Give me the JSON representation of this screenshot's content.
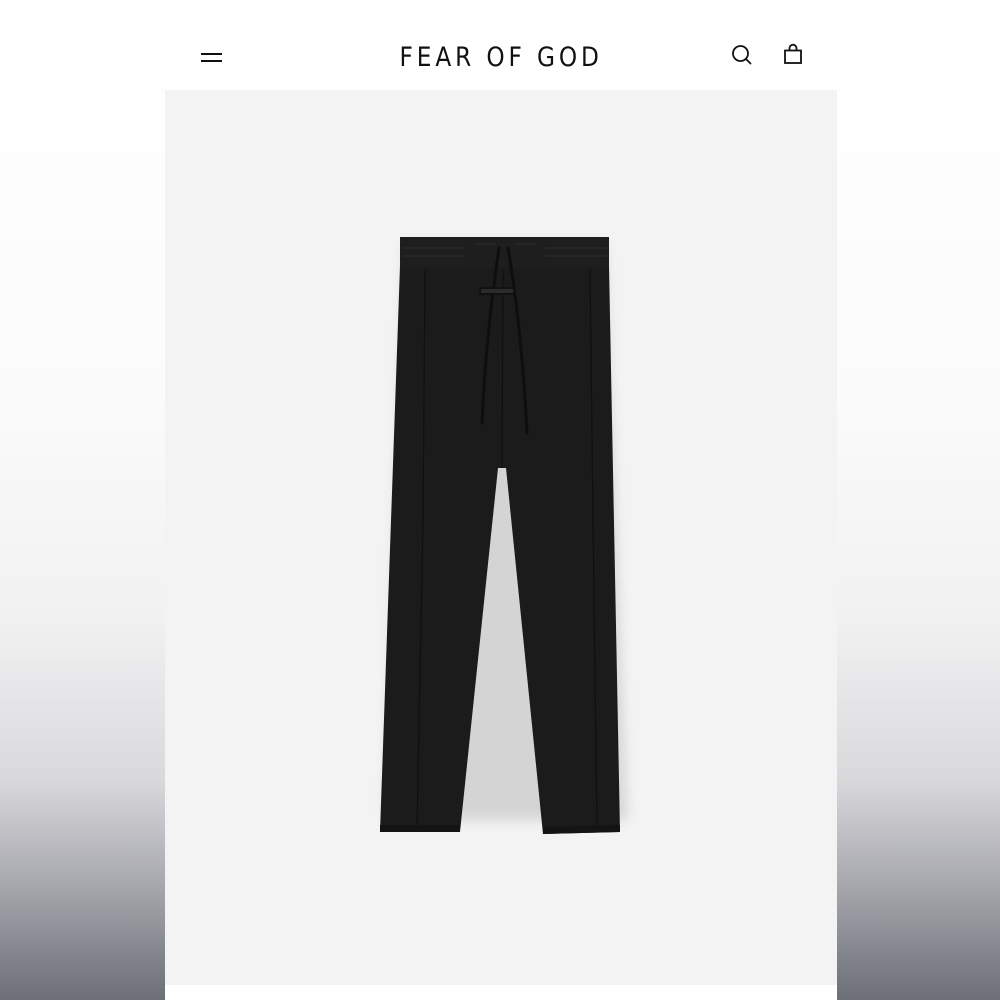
{
  "header": {
    "brand": "FEAR OF GOD",
    "menu_icon": "hamburger-menu-icon",
    "search_icon": "search-icon",
    "bag_icon": "shopping-bag-icon"
  },
  "product": {
    "image": "black-drawstring-trousers",
    "image_background": "#f3f3f3",
    "garment_color": "#1b1b1b"
  }
}
